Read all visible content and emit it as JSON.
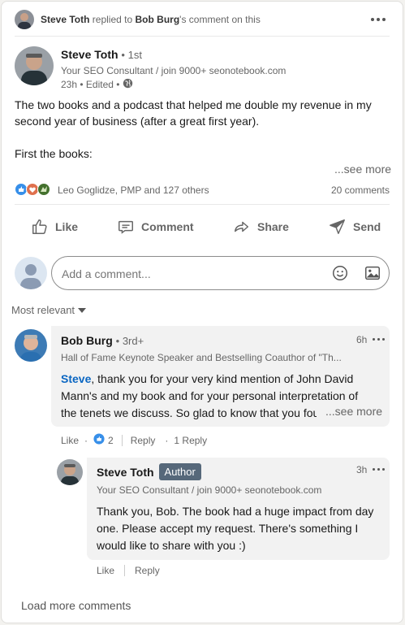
{
  "context": {
    "actor": "Steve Toth",
    "action_text": "replied to",
    "target": "Bob Burg",
    "suffix": "'s comment on this"
  },
  "post": {
    "author": "Steve Toth",
    "connection": "• 1st",
    "headline": "Your SEO Consultant / join 9000+ seonotebook.com",
    "meta": "23h • Edited •",
    "body_line1": "The two books and a podcast that helped me double my revenue in my",
    "body_line2": "second year of business (after a great first year).",
    "body_line3": "First the books:",
    "see_more": "...see more",
    "reactions_text": "Leo Goglidze, PMP and 127 others",
    "comments_count": "20 comments"
  },
  "actions": {
    "like": "Like",
    "comment": "Comment",
    "share": "Share",
    "send": "Send"
  },
  "comment_box": {
    "placeholder": "Add a comment..."
  },
  "sort": {
    "label": "Most relevant"
  },
  "comment1": {
    "author": "Bob Burg",
    "degree": "• 3rd+",
    "time": "6h",
    "headline": "Hall of Fame Keynote Speaker and Bestselling Coauthor of \"Th...",
    "mention": "Steve",
    "text_line1": ", thank you for your very kind mention of John David",
    "text_line2": "Mann's and my book and for your personal interpretation of",
    "text_line3": "the tenets we discuss. So glad to know that you fou",
    "see_more": "...see more",
    "like": "Like",
    "like_count": "2",
    "reply": "Reply",
    "reply_count": "1 Reply"
  },
  "reply1": {
    "author": "Steve Toth",
    "badge": "Author",
    "time": "3h",
    "headline": "Your SEO Consultant / join 9000+ seonotebook.com",
    "text_line1": "Thank you, Bob. The book had a huge impact from day",
    "text_line2": "one. Please accept my request. There's something I",
    "text_line3": "would like to share with you :)",
    "like": "Like",
    "reply": "Reply"
  },
  "load_more": "Load more comments",
  "colors": {
    "link": "#0a66c2",
    "author_badge": "#56687a",
    "bubble": "#f2f2f2"
  }
}
